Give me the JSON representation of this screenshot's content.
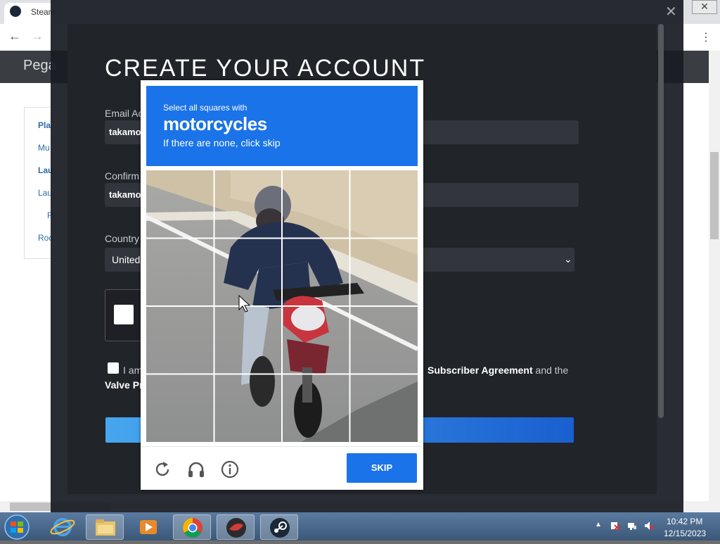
{
  "browser": {
    "tab_title": "Steam",
    "close_glyph": "✕",
    "back_glyph": "←",
    "forward_glyph": "→",
    "menu_glyph": "⋮"
  },
  "page": {
    "header_text": "Pega",
    "sidebar_links": [
      "Pla",
      "Mu",
      "Lau",
      "Lau",
      "R",
      "Roc"
    ]
  },
  "modal": {
    "close_glyph": "✕",
    "title": "CREATE YOUR ACCOUNT",
    "email_label": "Email Ac",
    "email_value": "takamo",
    "confirm_label": "Confirm",
    "confirm_value": "takamo",
    "country_label": "Country",
    "country_value": "United",
    "agree_prefix": "I am",
    "agree_subscriber": "Subscriber Agreement",
    "agree_suffix": "and the",
    "valve_text": "Valve Pr"
  },
  "hcaptcha": {
    "instruction": "Select all squares with",
    "target": "motorcycles",
    "fallback": "If there are none, click skip",
    "skip_label": "SKIP",
    "refresh_icon": "refresh-icon",
    "audio_icon": "headphones-icon",
    "info_icon": "info-icon",
    "accent_color": "#1a73e8"
  },
  "taskbar": {
    "time": "10:42 PM",
    "date": "12/15/2023",
    "tray_arrow": "▲",
    "apps": [
      "internet-explorer",
      "file-explorer",
      "media-player",
      "chrome",
      "app-red",
      "steam"
    ]
  }
}
